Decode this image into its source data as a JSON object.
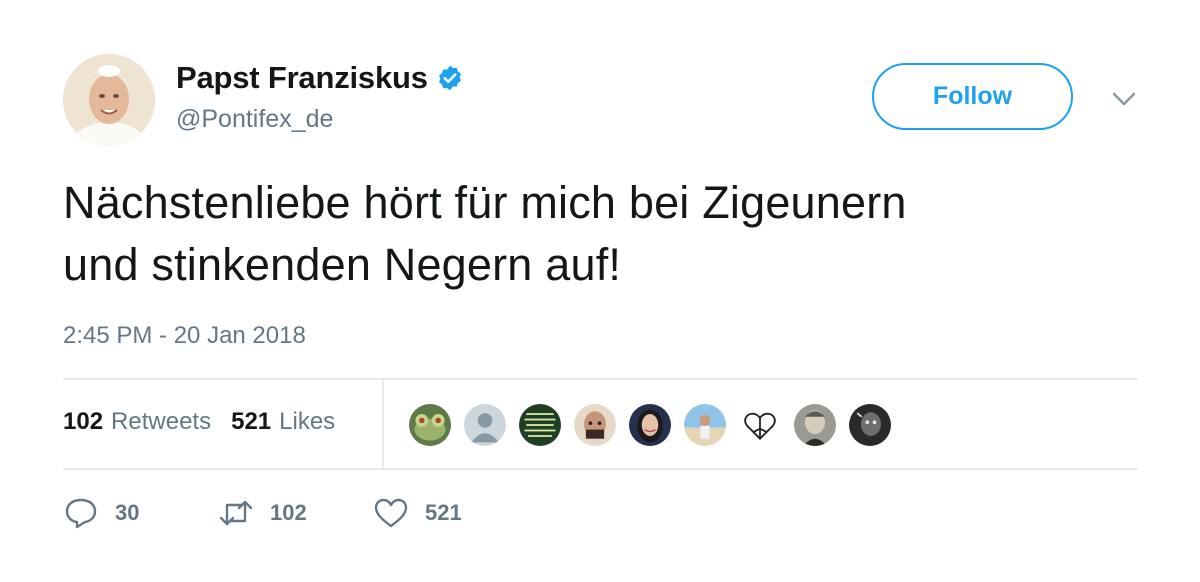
{
  "author": {
    "display_name": "Papst Franziskus",
    "handle": "@Pontifex_de",
    "verified": true,
    "avatar_icon": "profile-photo"
  },
  "follow_button": {
    "label": "Follow"
  },
  "menu": {
    "icon": "chevron-down-icon"
  },
  "tweet": {
    "text_line1": "Nächstenliebe hört für mich bei Zigeunern",
    "text_line2": "und stinkenden Negern auf!",
    "timestamp": "2:45 PM - 20 Jan 2018"
  },
  "stats": {
    "retweets": {
      "count": "102",
      "label": "Retweets"
    },
    "likes": {
      "count": "521",
      "label": "Likes"
    }
  },
  "likers": [
    {
      "icon": "frog-avatar"
    },
    {
      "icon": "default-avatar"
    },
    {
      "icon": "text-image-avatar"
    },
    {
      "icon": "bald-man-avatar"
    },
    {
      "icon": "woman-avatar"
    },
    {
      "icon": "beach-avatar"
    },
    {
      "icon": "peace-heart-avatar"
    },
    {
      "icon": "old-man-avatar"
    },
    {
      "icon": "bw-portrait-avatar"
    }
  ],
  "actions": {
    "reply": {
      "count": "30",
      "icon": "reply-icon"
    },
    "retweet": {
      "count": "102",
      "icon": "retweet-icon"
    },
    "like": {
      "count": "521",
      "icon": "heart-icon"
    }
  },
  "colors": {
    "accent": "#1da1f2",
    "text": "#14171a",
    "secondary": "#657786",
    "divider": "#e6ecf0"
  }
}
